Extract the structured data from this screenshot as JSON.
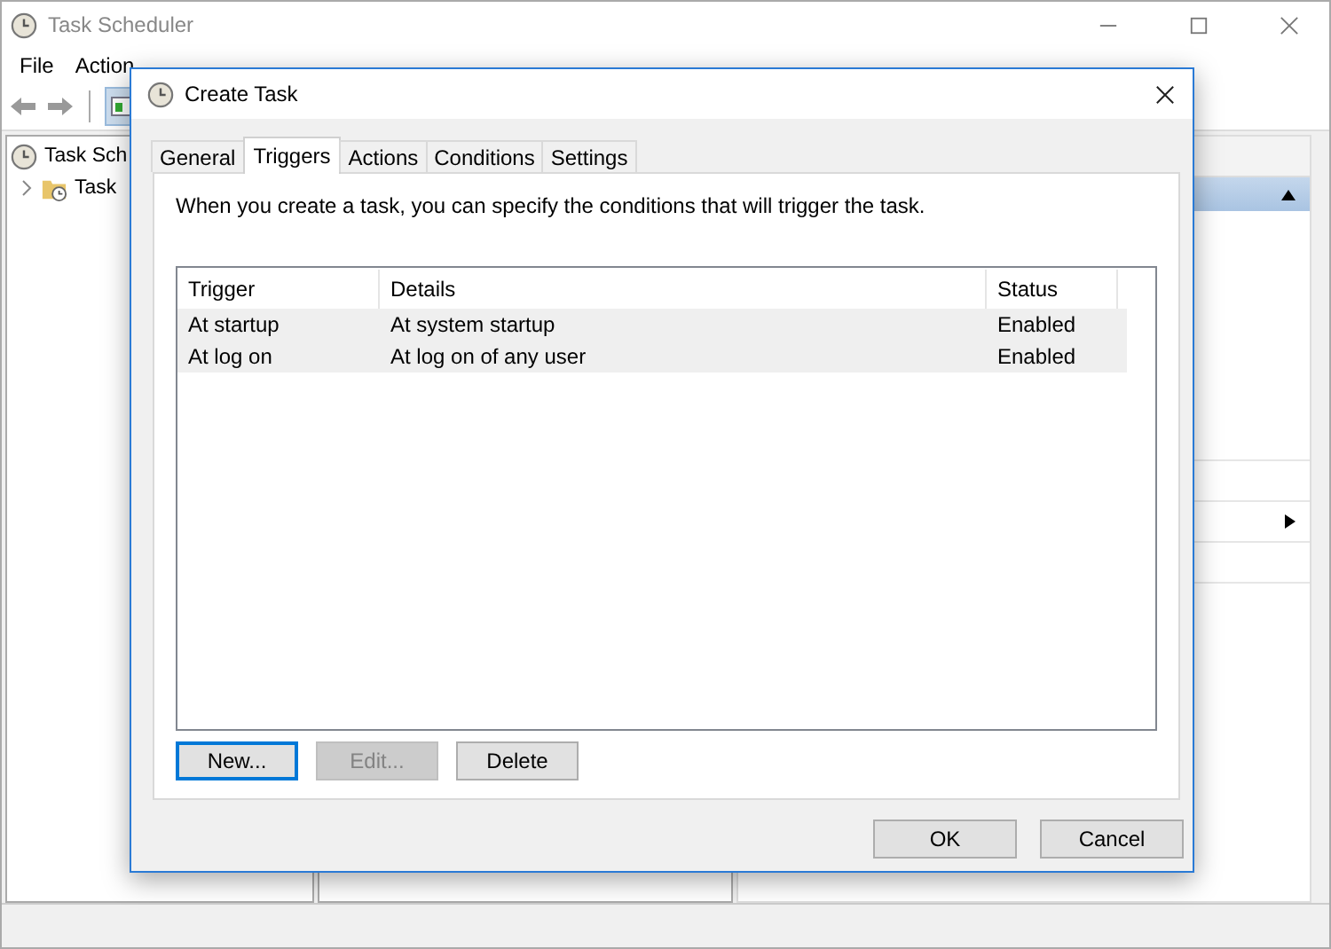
{
  "window": {
    "title": "Task Scheduler"
  },
  "menu": [
    {
      "label": "File"
    },
    {
      "label": "Action"
    }
  ],
  "tree": [
    {
      "label": "Task Sch",
      "children": [
        {
          "label": "Task",
          "expanded": false
        }
      ]
    }
  ],
  "dialog": {
    "title": "Create Task",
    "tabs": [
      {
        "label": "General",
        "selected": false
      },
      {
        "label": "Triggers",
        "selected": true
      },
      {
        "label": "Actions",
        "selected": false
      },
      {
        "label": "Conditions",
        "selected": false
      },
      {
        "label": "Settings",
        "selected": false
      }
    ],
    "description": "When you create a task, you can specify the conditions that will trigger the task.",
    "table": {
      "columns": [
        "Trigger",
        "Details",
        "Status"
      ],
      "rows": [
        [
          "At startup",
          "At system startup",
          "Enabled"
        ],
        [
          "At log on",
          "At log on of any user",
          "Enabled"
        ]
      ]
    },
    "list_buttons": [
      {
        "label": "New...",
        "disabled": false,
        "focused": true
      },
      {
        "label": "Edit...",
        "disabled": true,
        "focused": false
      },
      {
        "label": "Delete",
        "disabled": false,
        "focused": false
      }
    ],
    "buttons": [
      "OK",
      "Cancel"
    ]
  }
}
